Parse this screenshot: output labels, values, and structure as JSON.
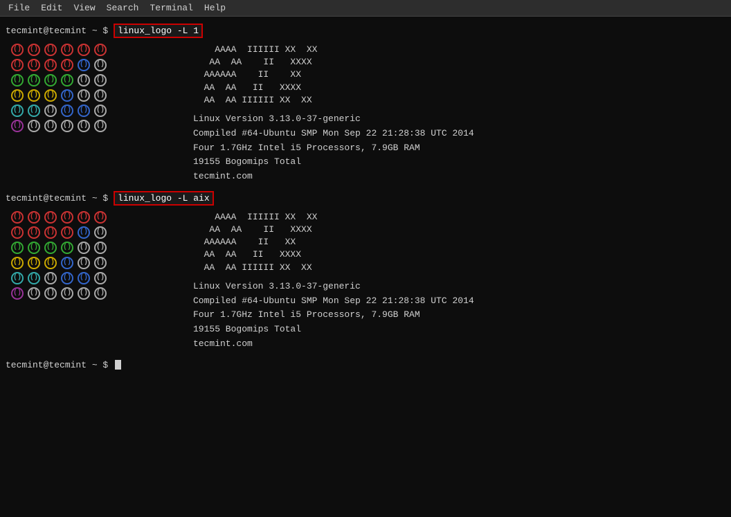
{
  "menubar": {
    "items": [
      "File",
      "Edit",
      "View",
      "Search",
      "Terminal",
      "Help"
    ]
  },
  "terminal": {
    "prompt": "tecmint@tecmint ~ $ ",
    "command1": "linux_logo -L 1",
    "command2": "linux_logo -L aix",
    "ascii_art1": "    AAAA  IIIIII XX  XX\n   AA  AA    II   XXXX\n  AAAAAA    II    XX\n  AA  AA   II   XXXX\n  AA  AA IIIIII XX  XX",
    "sysinfo1": "Linux Version 3.13.0-37-generic\nCompiled #64-Ubuntu SMP Mon Sep 22 21:28:38 UTC 2014\nFour 1.7GHz Intel i5 Processors, 7.9GB RAM\n19155 Bogomips Total\ntecmint.com",
    "ascii_art2": "    AAAA  IIIIII XX  XX\n   AA  AA    II   XXXX\n  AAAAAA    II   XX\n  AA  AA   II   XXXX\n  AA  AA IIIIII XX  XX",
    "sysinfo2": "Linux Version 3.13.0-37-generic\nCompiled #64-Ubuntu SMP Mon Sep 22 21:28:38 UTC 2014\nFour 1.7GHz Intel i5 Processors, 7.9GB RAM\n19155 Bogomips Total\ntecmint.com",
    "bottom_prompt": "tecmint@tecmint ~ $ "
  },
  "circles": {
    "row1": [
      {
        "color": "red"
      },
      {
        "color": "red"
      },
      {
        "color": "red"
      },
      {
        "color": "red"
      },
      {
        "color": "red"
      },
      {
        "color": "red"
      }
    ],
    "row2": [
      {
        "color": "red"
      },
      {
        "color": "red"
      },
      {
        "color": "red"
      },
      {
        "color": "red"
      },
      {
        "color": "blue"
      },
      {
        "color": "white"
      }
    ],
    "row3": [
      {
        "color": "green"
      },
      {
        "color": "green"
      },
      {
        "color": "green"
      },
      {
        "color": "green"
      },
      {
        "color": "white"
      },
      {
        "color": "white"
      }
    ],
    "row4": [
      {
        "color": "yellow"
      },
      {
        "color": "yellow"
      },
      {
        "color": "yellow"
      },
      {
        "color": "blue"
      },
      {
        "color": "white"
      },
      {
        "color": "white"
      }
    ],
    "row5": [
      {
        "color": "cyan"
      },
      {
        "color": "cyan"
      },
      {
        "color": "white"
      },
      {
        "color": "blue"
      },
      {
        "color": "blue"
      },
      {
        "color": "white"
      }
    ],
    "row6": [
      {
        "color": "purple"
      },
      {
        "color": "white"
      },
      {
        "color": "white"
      },
      {
        "color": "white"
      },
      {
        "color": "white"
      },
      {
        "color": "white"
      }
    ]
  }
}
